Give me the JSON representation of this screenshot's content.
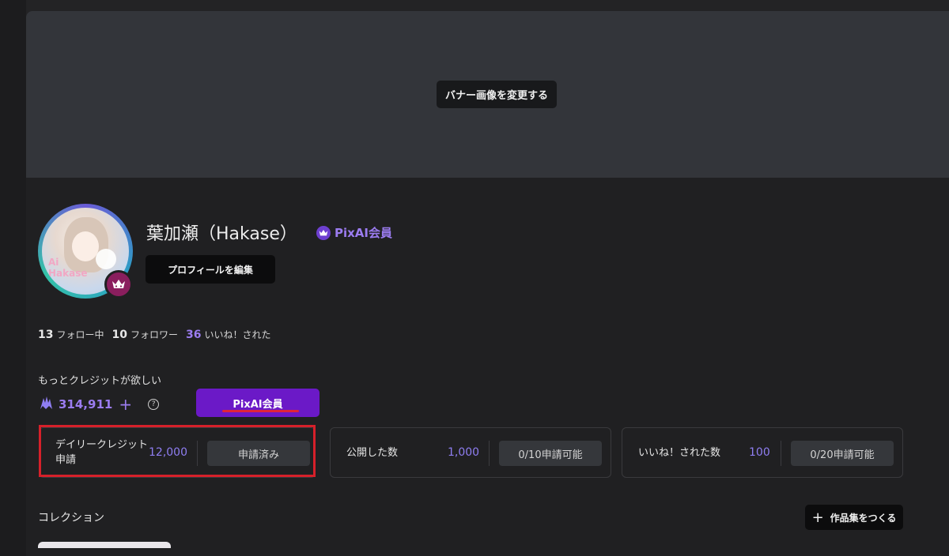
{
  "banner": {
    "change_label": "バナー画像を変更する"
  },
  "profile": {
    "avatar_text_line1": "Ai",
    "avatar_text_line2": "Hakase",
    "username": "葉加瀬（Hakase）",
    "member_badge": "PixAI会員",
    "edit_label": "プロフィールを編集"
  },
  "stats": {
    "following_count": "13",
    "following_label": "フォロー中",
    "followers_count": "10",
    "followers_label": "フォロワー",
    "likes_count": "36",
    "likes_label": "いいね！された"
  },
  "credits": {
    "title": "もっとクレジットが欲しい",
    "amount": "314,911",
    "plus": "+",
    "help": "?",
    "member_button": "PixAI会員"
  },
  "cards": [
    {
      "label_line1": "デイリークレジット",
      "label_line2": "申請",
      "value": "12,000",
      "button": "申請済み"
    },
    {
      "label": "公開した数",
      "value": "1,000",
      "button": "0/10申請可能"
    },
    {
      "label": "いいね！された数",
      "value": "100",
      "button": "0/20申請可能"
    }
  ],
  "collection": {
    "title": "コレクション",
    "create_label": "作品集をつくる",
    "create_icon": "+"
  },
  "colors": {
    "accent": "#9b7cf0",
    "member_button": "#6b19c7",
    "highlight": "#d6202a"
  }
}
